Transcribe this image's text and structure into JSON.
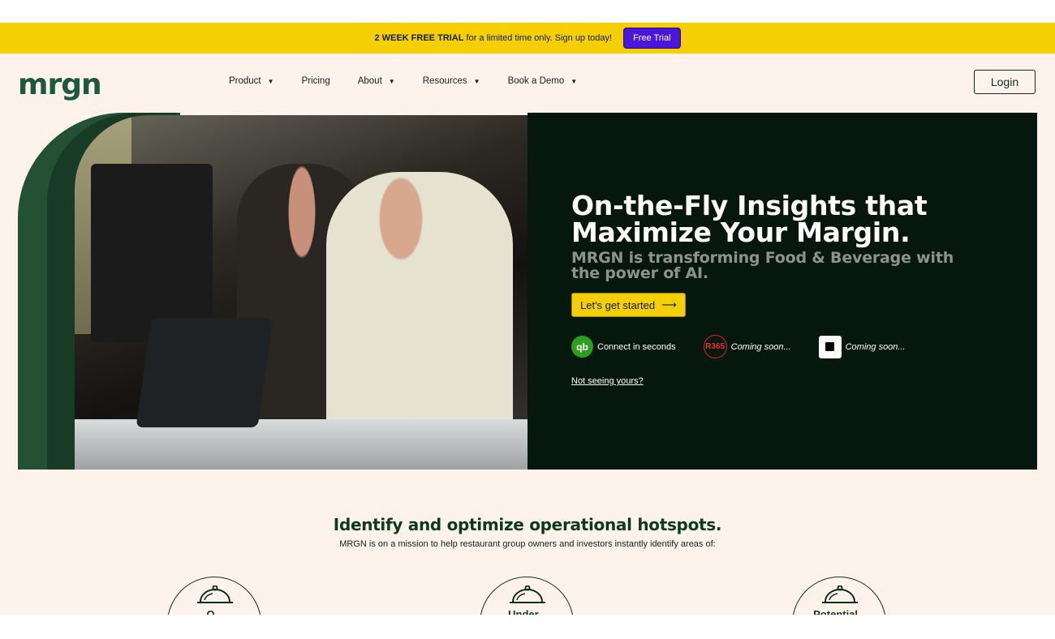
{
  "banner": {
    "strong": "2 WEEK FREE TRIAL",
    "text": " for a limited time only. Sign up today!",
    "button": "Free Trial"
  },
  "nav": {
    "logo": "mrgn",
    "items": [
      {
        "label": "Product",
        "dropdown": true
      },
      {
        "label": "Pricing",
        "dropdown": false
      },
      {
        "label": "About",
        "dropdown": true
      },
      {
        "label": "Resources",
        "dropdown": true
      },
      {
        "label": "Book a Demo",
        "dropdown": true
      }
    ],
    "login": "Login"
  },
  "hero": {
    "headline_line1": "On-the-Fly Insights that",
    "headline_line2": "Maximize Your Margin.",
    "subheadline": "MRGN is transforming Food & Beverage with the power of AI.",
    "cta": "Let's get started",
    "cta_arrow": "⟶",
    "integrations": [
      {
        "icon": "qb",
        "icon_name": "quickbooks-icon",
        "label": "Connect in seconds",
        "italic": false
      },
      {
        "icon": "R365",
        "icon_name": "r365-icon",
        "label": "Coming soon...",
        "italic": true
      },
      {
        "icon": "square",
        "icon_name": "square-icon",
        "label": "Coming soon...",
        "italic": true
      }
    ],
    "not_seeing": "Not seeing yours?"
  },
  "section": {
    "title": "Identify and optimize operational hotspots.",
    "subtitle": "MRGN is on a mission to help restaurant group owners and investors instantly identify areas of:",
    "cards": [
      "O...",
      "Under...",
      "Potential..."
    ]
  },
  "colors": {
    "banner": "#f3cf04",
    "trial_button": "#4a17d9",
    "brand_green": "#1d5a3c",
    "hero_dark": "#06180d",
    "cta_yellow": "#f5cf06",
    "page_bg": "#fdf3ea"
  }
}
